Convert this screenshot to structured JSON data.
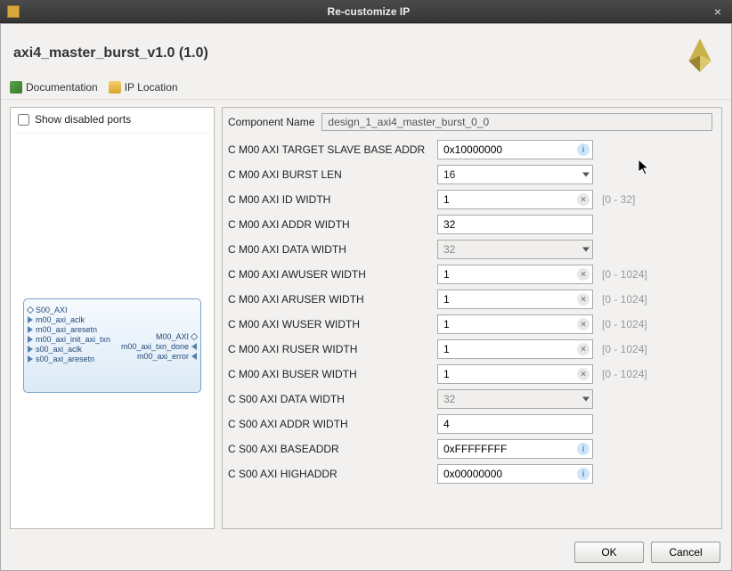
{
  "window": {
    "title": "Re-customize IP"
  },
  "header": {
    "heading": "axi4_master_burst_v1.0 (1.0)"
  },
  "toolbar": {
    "documentation_label": "Documentation",
    "ip_location_label": "IP Location"
  },
  "left": {
    "show_disabled_label": "Show disabled ports",
    "ports_left": [
      "S00_AXI",
      "m00_axi_aclk",
      "m00_axi_aresetn",
      "m00_axi_init_axi_txn",
      "s00_axi_aclk",
      "s00_axi_aresetn"
    ],
    "ports_right": [
      "M00_AXI",
      "m00_axi_txn_done",
      "m00_axi_error"
    ]
  },
  "component": {
    "label": "Component Name",
    "value": "design_1_axi4_master_burst_0_0"
  },
  "params": [
    {
      "label": "C M00 AXI TARGET SLAVE BASE ADDR",
      "value": "0x10000000",
      "kind": "text",
      "adorn": "info"
    },
    {
      "label": "C M00 AXI BURST LEN",
      "value": "16",
      "kind": "select"
    },
    {
      "label": "C M00 AXI ID WIDTH",
      "value": "1",
      "kind": "text",
      "adorn": "clear",
      "range": "[0 - 32]"
    },
    {
      "label": "C M00 AXI ADDR WIDTH",
      "value": "32",
      "kind": "text"
    },
    {
      "label": "C M00 AXI DATA WIDTH",
      "value": "32",
      "kind": "select",
      "disabled": true
    },
    {
      "label": "C M00 AXI AWUSER WIDTH",
      "value": "1",
      "kind": "text",
      "adorn": "clear",
      "range": "[0 - 1024]"
    },
    {
      "label": "C M00 AXI ARUSER WIDTH",
      "value": "1",
      "kind": "text",
      "adorn": "clear",
      "range": "[0 - 1024]"
    },
    {
      "label": "C M00 AXI WUSER WIDTH",
      "value": "1",
      "kind": "text",
      "adorn": "clear",
      "range": "[0 - 1024]"
    },
    {
      "label": "C M00 AXI RUSER WIDTH",
      "value": "1",
      "kind": "text",
      "adorn": "clear",
      "range": "[0 - 1024]"
    },
    {
      "label": "C M00 AXI BUSER WIDTH",
      "value": "1",
      "kind": "text",
      "adorn": "clear",
      "range": "[0 - 1024]"
    },
    {
      "label": "C S00 AXI DATA WIDTH",
      "value": "32",
      "kind": "select",
      "disabled": true
    },
    {
      "label": "C S00 AXI ADDR WIDTH",
      "value": "4",
      "kind": "text"
    },
    {
      "label": "C S00 AXI BASEADDR",
      "value": "0xFFFFFFFF",
      "kind": "text",
      "adorn": "info"
    },
    {
      "label": "C S00 AXI HIGHADDR",
      "value": "0x00000000",
      "kind": "text",
      "adorn": "info"
    }
  ],
  "buttons": {
    "ok": "OK",
    "cancel": "Cancel"
  }
}
